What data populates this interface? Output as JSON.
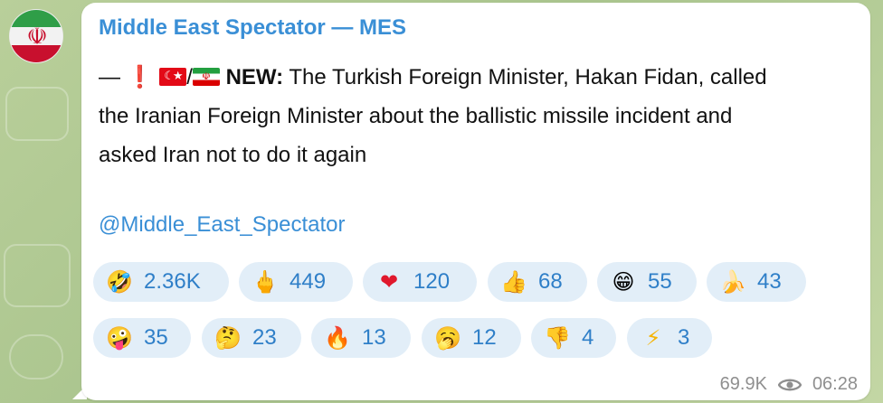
{
  "channel": {
    "name": "Middle East Spectator — MES"
  },
  "message": {
    "prefix": "—",
    "alert_emoji": "❗",
    "flag_separator": "/",
    "label": "NEW:",
    "line1_rest": " The Turkish Foreign Minister, Hakan Fidan, called",
    "line2": "the Iranian Foreign Minister about the ballistic missile incident and",
    "line3": "asked Iran not to do it again",
    "mention": "@Middle_East_Spectator"
  },
  "reactions": [
    {
      "icon": "rofl-face-icon",
      "emoji": "🤣",
      "count": "2.36K"
    },
    {
      "icon": "middle-finger-icon",
      "emoji": "🖕",
      "count": "449"
    },
    {
      "icon": "red-heart-icon",
      "emoji": "❤",
      "count": "120"
    },
    {
      "icon": "thumbs-up-icon",
      "emoji": "👍",
      "count": "68"
    },
    {
      "icon": "grinning-face-icon",
      "emoji": "😁",
      "count": "55"
    },
    {
      "icon": "banana-icon",
      "emoji": "🍌",
      "count": "43"
    },
    {
      "icon": "zany-face-icon",
      "emoji": "🤪",
      "count": "35"
    },
    {
      "icon": "thinking-face-icon",
      "emoji": "🤔",
      "count": "23"
    },
    {
      "icon": "fire-icon",
      "emoji": "🔥",
      "count": "13"
    },
    {
      "icon": "yawning-face-icon",
      "emoji": "🥱",
      "count": "12"
    },
    {
      "icon": "thumbs-down-icon",
      "emoji": "👎",
      "count": "4"
    },
    {
      "icon": "high-voltage-icon",
      "emoji": "⚡",
      "count": "3"
    }
  ],
  "meta": {
    "views": "69.9K",
    "time": "06:28"
  },
  "colors": {
    "link": "#3a8fd6",
    "reaction_bg": "#e2eef8",
    "reaction_count": "#2f7fc8",
    "meta_gray": "#8f8f8f"
  }
}
